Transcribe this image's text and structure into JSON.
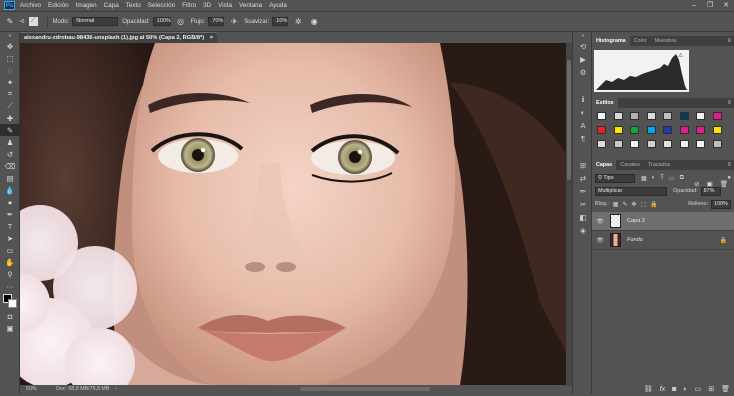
{
  "app": {
    "logo": "Ps"
  },
  "menu": [
    "Archivo",
    "Edición",
    "Imagen",
    "Capa",
    "Texto",
    "Selección",
    "Filtro",
    "3D",
    "Vista",
    "Ventana",
    "Ayuda"
  ],
  "window_controls": [
    "–",
    "❐",
    "✕"
  ],
  "options": {
    "mode_label": "Modo:",
    "mode_value": "Normal",
    "opacity_label": "Opacidad:",
    "opacity_value": "100%",
    "flow_label": "Flujo:",
    "flow_value": "70%",
    "smooth_label": "Suavizar:",
    "smooth_value": "10%",
    "brush_size": "5"
  },
  "document": {
    "tab_title": "alexandru-zdrobau-98436-unsplash (1).jpg al 50% (Capa 2, RGB/8*)",
    "close": "×"
  },
  "status": {
    "zoom": "50%",
    "doc_info": "Doc: 68,8 MB/75,8 MB",
    "arrow": "›"
  },
  "histogram_panel": {
    "tabs": [
      "Histograma",
      "Color",
      "Muestras"
    ],
    "menu": "≡"
  },
  "styles_panel": {
    "title": "Estilos",
    "menu": "≡",
    "swatches": [
      "#f4f4f4",
      "#d9d9d9",
      "#b0b0b0",
      "#dcdcdc",
      "#bfbfbf",
      "#0f3b52",
      "#f4f4f4",
      "#e8188f",
      "#e8231c",
      "#ffe600",
      "#12a837",
      "#00a9e6",
      "#1c3fa8",
      "#e8188f",
      "#e8188f",
      "#ffe600",
      "#d9d9d9",
      "#c9c9c9",
      "#f4f4f4",
      "#cfcfcf",
      "#e0e0e0",
      "#f0f0f0",
      "#f4f4f4",
      "#bdbdbd"
    ]
  },
  "layers_panel": {
    "tabs": [
      "Capas",
      "Canales",
      "Trazados"
    ],
    "menu": "≡",
    "filter_label": "Tipo",
    "blend_mode": "Multiplicar",
    "opacity_label": "Opacidad:",
    "opacity_value": "87%",
    "lock_label": "Bloq.:",
    "fill_label": "Relleno:",
    "fill_value": "100%",
    "layers": [
      {
        "name": "Capa 2",
        "selected": true,
        "locked": false
      },
      {
        "name": "Fondo",
        "selected": false,
        "locked": true
      }
    ],
    "bottom_icons": [
      "link-icon",
      "fx-icon",
      "mask-icon",
      "adjustment-icon",
      "group-icon",
      "new-layer-icon",
      "trash-icon"
    ]
  },
  "colors": {
    "accent": "#31a8ff",
    "panel_bg": "#535353",
    "dark_bg": "#3f3f3f"
  }
}
